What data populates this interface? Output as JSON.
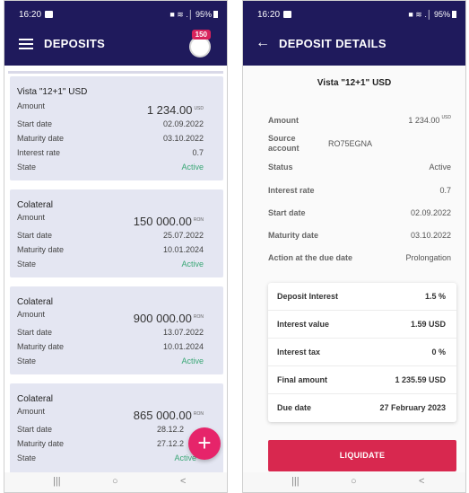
{
  "left": {
    "status": {
      "time": "16:20",
      "signal": "■ ≋ .│ 95%"
    },
    "title": "DEPOSITS",
    "notification_count": "150",
    "deposits": [
      {
        "name": "Vista \"12+1\" USD",
        "amount_label": "Amount",
        "amount": "1 234.00",
        "currency": "USD",
        "start_label": "Start date",
        "start_date": "02.09.2022",
        "maturity_label": "Maturity date",
        "maturity_date": "03.10.2022",
        "rate_label": "Interest rate",
        "rate": "0.7",
        "state_label": "State",
        "state": "Active"
      },
      {
        "name": "Colateral",
        "amount_label": "Amount",
        "amount": "150 000.00",
        "currency": "RON",
        "start_label": "Start date",
        "start_date": "25.07.2022",
        "maturity_label": "Maturity date",
        "maturity_date": "10.01.2024",
        "state_label": "State",
        "state": "Active"
      },
      {
        "name": "Colateral",
        "amount_label": "Amount",
        "amount": "900 000.00",
        "currency": "RON",
        "start_label": "Start date",
        "start_date": "13.07.2022",
        "maturity_label": "Maturity date",
        "maturity_date": "10.01.2024",
        "state_label": "State",
        "state": "Active"
      },
      {
        "name": "Colateral",
        "amount_label": "Amount",
        "amount": "865 000.00",
        "currency": "RON",
        "start_label": "Start date",
        "start_date": "28.12.2",
        "maturity_label": "Maturity date",
        "maturity_date": "27.12.2",
        "state_label": "State",
        "state": "Active"
      }
    ],
    "fab_label": "+",
    "nav": {
      "recent": "|||",
      "home": "○",
      "back": "<"
    }
  },
  "right": {
    "status": {
      "time": "16:20",
      "signal": "■ ≋ .│ 95%"
    },
    "title": "DEPOSIT DETAILS",
    "back_icon": "←",
    "deposit_name": "Vista \"12+1\" USD",
    "fields": {
      "amount_label": "Amount",
      "amount": "1 234.00",
      "currency": "USD",
      "source_label": "Source account",
      "source": "RO75EGNA",
      "status_label": "Status",
      "status": "Active",
      "rate_label": "Interest rate",
      "rate": "0.7",
      "start_label": "Start date",
      "start_date": "02.09.2022",
      "maturity_label": "Maturity date",
      "maturity_date": "03.10.2022",
      "action_label": "Action at the due date",
      "action": "Prolongation"
    },
    "summary": [
      {
        "label": "Deposit Interest",
        "value": "1.5 %"
      },
      {
        "label": "Interest value",
        "value": "1.59 USD"
      },
      {
        "label": "Interest tax",
        "value": "0 %"
      },
      {
        "label": "Final amount",
        "value": "1 235.59 USD"
      },
      {
        "label": "Due date",
        "value": "27 February 2023"
      }
    ],
    "liquidate_label": "LIQUIDATE",
    "nav": {
      "recent": "|||",
      "home": "○",
      "back": "<"
    }
  },
  "colors": {
    "header": "#1f1a5c",
    "accent": "#e6246a",
    "active": "#3aa776",
    "button": "#d8284f"
  }
}
